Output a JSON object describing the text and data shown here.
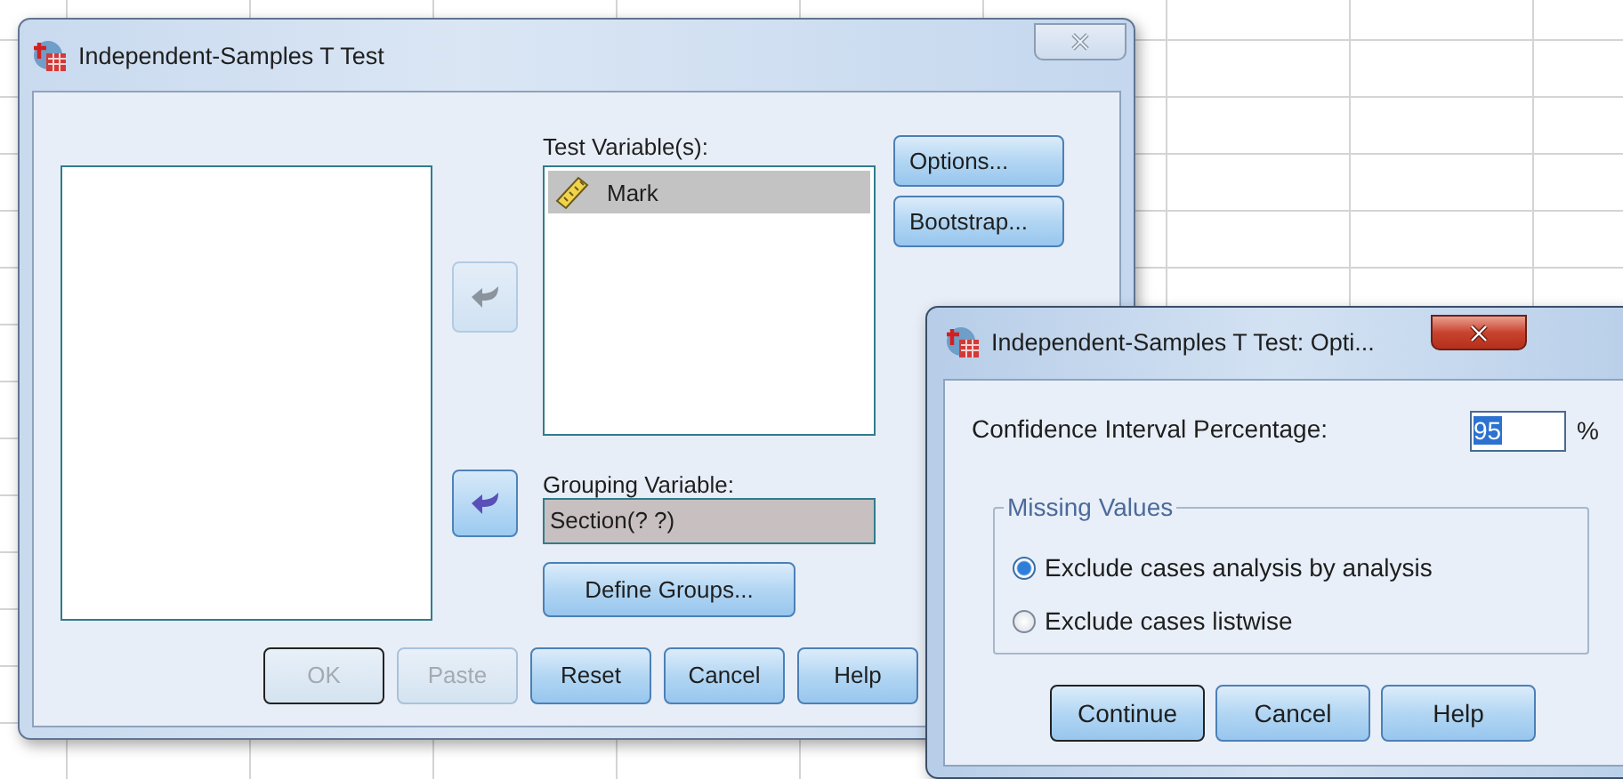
{
  "main_dialog": {
    "title": "Independent-Samples T Test",
    "test_variables": {
      "label": "Test Variable(s):",
      "items": [
        {
          "name": "Mark",
          "selected": true
        }
      ]
    },
    "move_buttons": [
      {
        "disabled": true
      },
      {
        "disabled": false
      }
    ],
    "side_buttons": [
      {
        "label": "Options..."
      },
      {
        "label": "Bootstrap..."
      }
    ],
    "grouping_variable": {
      "label": "Grouping Variable:",
      "value": "Section(? ?)"
    },
    "define_groups_button": {
      "label": "Define Groups..."
    },
    "buttons": [
      {
        "label": "OK",
        "disabled": true,
        "default": true
      },
      {
        "label": "Paste",
        "disabled": true,
        "default": false
      },
      {
        "label": "Reset",
        "disabled": false,
        "default": false
      },
      {
        "label": "Cancel",
        "disabled": false,
        "default": false
      },
      {
        "label": "Help",
        "disabled": false,
        "default": false
      }
    ]
  },
  "options_dialog": {
    "title": "Independent-Samples T Test: Opti...",
    "confidence": {
      "label": "Confidence Interval Percentage:",
      "value": "95",
      "unit": "%"
    },
    "missing_values": {
      "legend": "Missing Values",
      "options": [
        {
          "label": "Exclude cases analysis by analysis",
          "selected": true
        },
        {
          "label": "Exclude cases listwise",
          "selected": false
        }
      ]
    },
    "buttons": [
      {
        "label": "Continue",
        "default": true
      },
      {
        "label": "Cancel",
        "default": false
      },
      {
        "label": "Help",
        "default": false
      }
    ]
  }
}
